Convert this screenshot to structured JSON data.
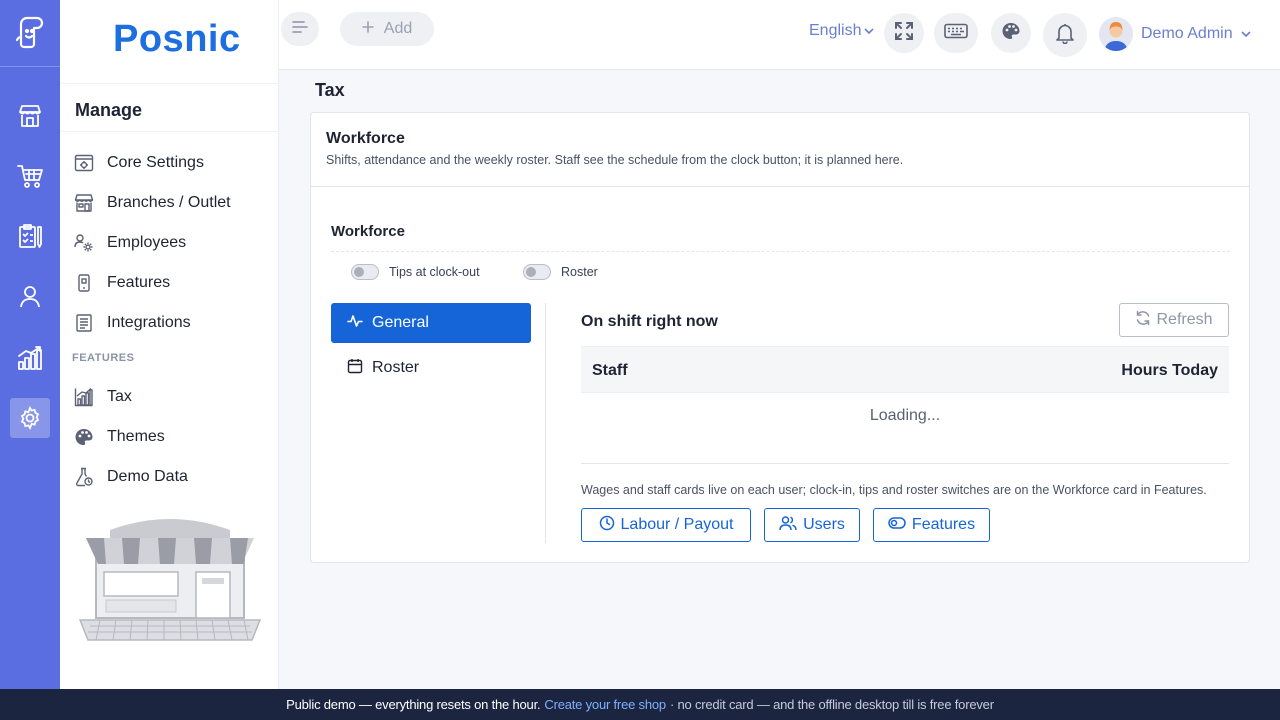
{
  "brand": {
    "name": "Posnic"
  },
  "header": {
    "add_label": "Add",
    "language": "English",
    "user_name": "Demo Admin"
  },
  "sidebar": {
    "title": "Manage",
    "items": [
      {
        "label": "Core Settings",
        "icon": "settings-sliders-icon"
      },
      {
        "label": "Branches / Outlet",
        "icon": "store-icon"
      },
      {
        "label": "Employees",
        "icon": "employees-gear-icon"
      },
      {
        "label": "Features",
        "icon": "device-icon"
      },
      {
        "label": "Integrations",
        "icon": "clipboard-list-icon"
      }
    ],
    "section_label": "FEATURES",
    "feature_items": [
      {
        "label": "Tax",
        "icon": "chart-icon"
      },
      {
        "label": "Themes",
        "icon": "palette-icon"
      },
      {
        "label": "Demo Data",
        "icon": "flask-icon"
      }
    ]
  },
  "page": {
    "title": "Tax",
    "card": {
      "title": "Workforce",
      "subtitle": "Shifts, attendance and the weekly roster. Staff see the schedule from the clock button; it is planned here.",
      "section_title": "Workforce",
      "toggles": [
        {
          "label": "Tips at clock-out",
          "on": false
        },
        {
          "label": "Roster",
          "on": false
        }
      ],
      "tabs": [
        {
          "label": "General",
          "active": true
        },
        {
          "label": "Roster",
          "active": false
        }
      ],
      "pane": {
        "title": "On shift right now",
        "refresh_label": "Refresh",
        "columns": [
          "Staff",
          "Hours Today"
        ],
        "loading_text": "Loading...",
        "note": "Wages and staff cards live on each user; clock-in, tips and roster switches are on the Workforce card in Features.",
        "buttons": [
          "Labour / Payout",
          "Users",
          "Features"
        ]
      }
    }
  },
  "banner": {
    "lead": "Public demo — everything resets on the hour.",
    "link": "Create your free shop",
    "tail": "· no credit card — and the offline desktop till is free forever"
  },
  "colors": {
    "rail": "#5b6ee1",
    "brand": "#1d6fe0",
    "primary": "#1565d8",
    "banner": "#1b2540"
  }
}
